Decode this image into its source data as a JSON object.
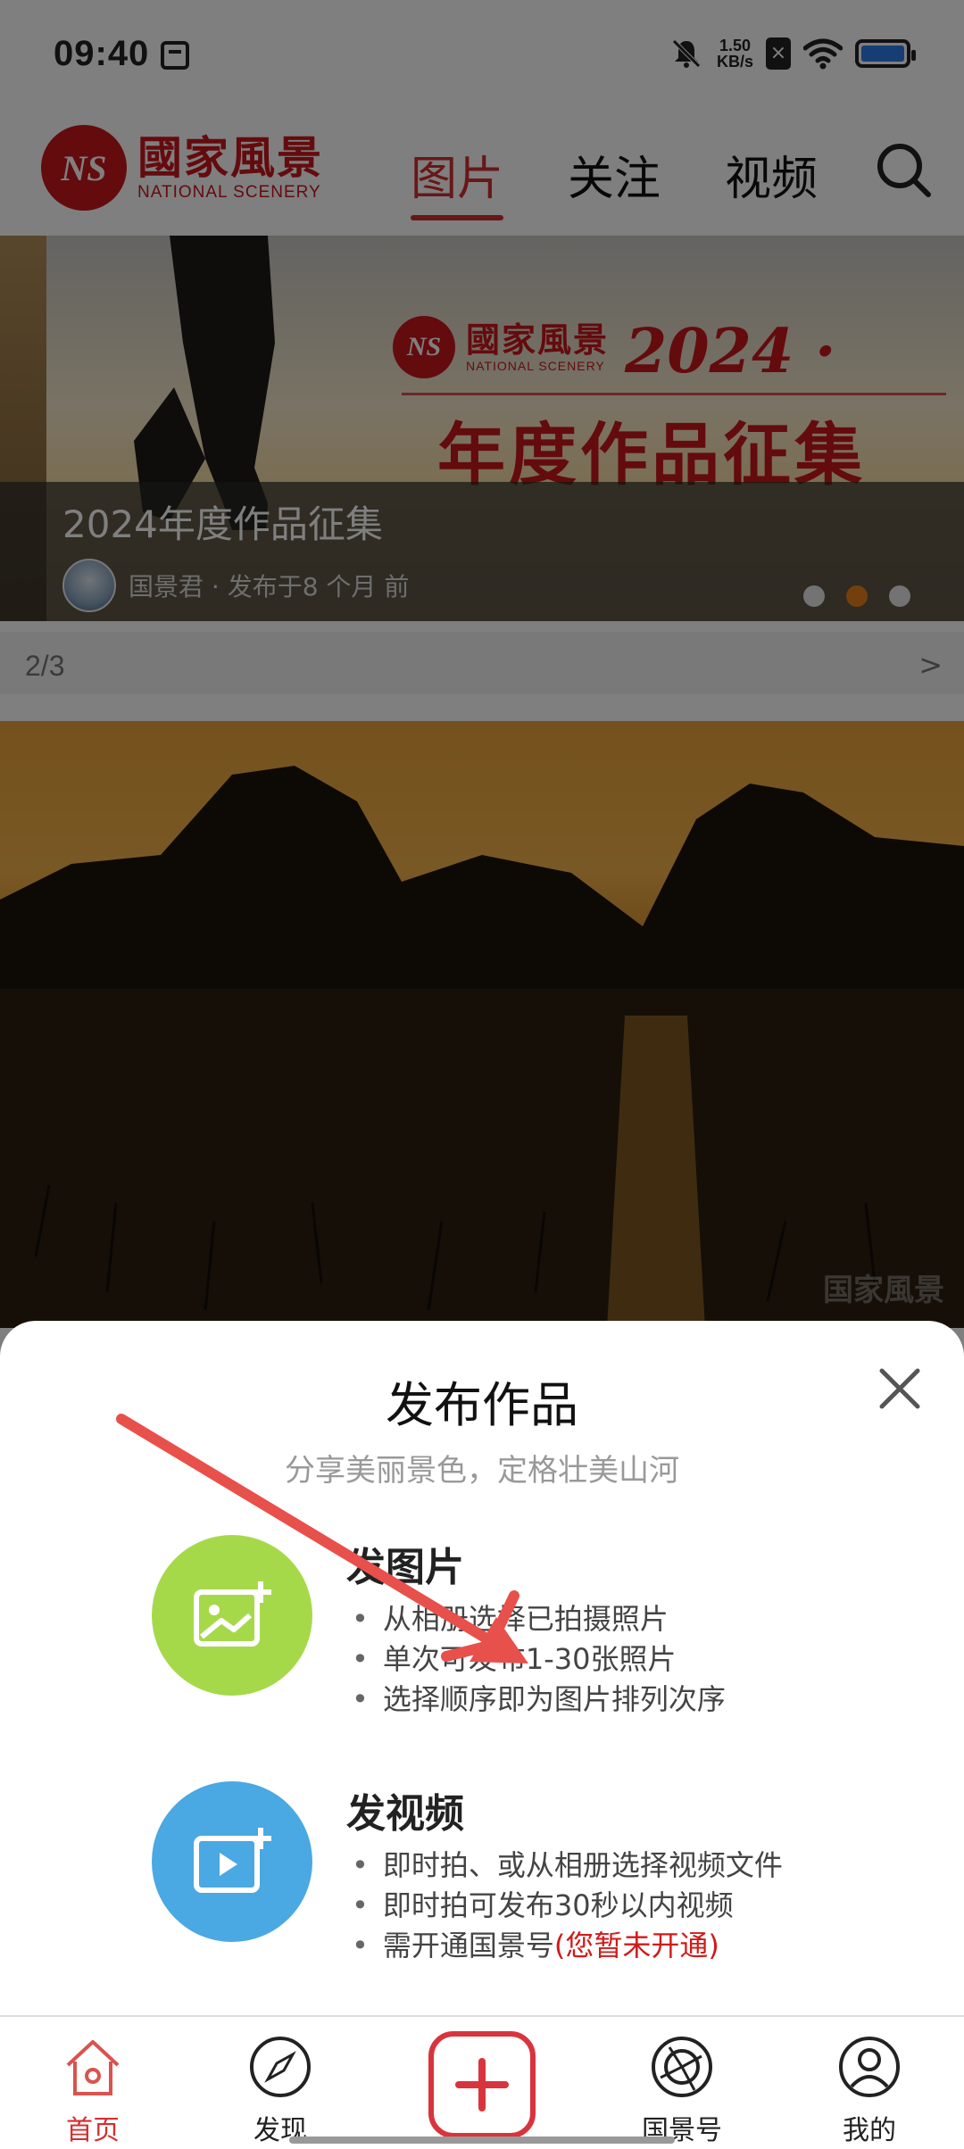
{
  "status_bar": {
    "time": "09:40",
    "speed_value": "1.50",
    "speed_unit": "KB/s",
    "sim_icon": "sim-disabled-icon",
    "battery_color": "#2f7bea"
  },
  "header": {
    "logo_mark": "NS",
    "logo_cn": "國家風景",
    "logo_en": "NATIONAL SCENERY",
    "tabs": [
      {
        "label": "图片",
        "active": true
      },
      {
        "label": "关注",
        "active": false
      },
      {
        "label": "视频",
        "active": false
      }
    ],
    "search_icon": "search-icon",
    "accent_color": "#c8161d"
  },
  "banner": {
    "logo_mark": "NS",
    "logo_cn": "國家風景",
    "logo_en": "NATIONAL SCENERY",
    "year": "2024 ·",
    "headline": "年度作品征集",
    "title": "2024年度作品征集",
    "author": "国景君",
    "meta": "国景君  · 发布于8 个月 前",
    "dots_total": 3,
    "dots_active": 2
  },
  "pager": {
    "count": "2/3",
    "next": ">"
  },
  "feed": {
    "watermark": "国家風景"
  },
  "sheet": {
    "title": "发布作品",
    "subtitle": "分享美丽景色，定格壮美山河",
    "close_icon": "close-icon",
    "options": [
      {
        "title": "发图片",
        "icon": "add-photo-icon",
        "lines": [
          "从相册选择已拍摄照片",
          "单次可发布1-30张照片",
          "选择顺序即为图片排列次序"
        ]
      },
      {
        "title": "发视频",
        "icon": "add-video-icon",
        "lines": [
          "即时拍、或从相册选择视频文件",
          "即时拍可发布30秒以内视频",
          "需开通国景号"
        ],
        "warning": "(您暂未开通)"
      }
    ]
  },
  "bottom_nav": {
    "items": [
      {
        "label": "首页",
        "icon": "home-icon",
        "active": true
      },
      {
        "label": "发现",
        "icon": "compass-icon",
        "active": false
      },
      {
        "label": "",
        "icon": "plus-icon",
        "active": false
      },
      {
        "label": "国景号",
        "icon": "camera-shutter-icon",
        "active": false
      },
      {
        "label": "我的",
        "icon": "profile-icon",
        "active": false
      }
    ],
    "active_color": "#d32f2f"
  }
}
